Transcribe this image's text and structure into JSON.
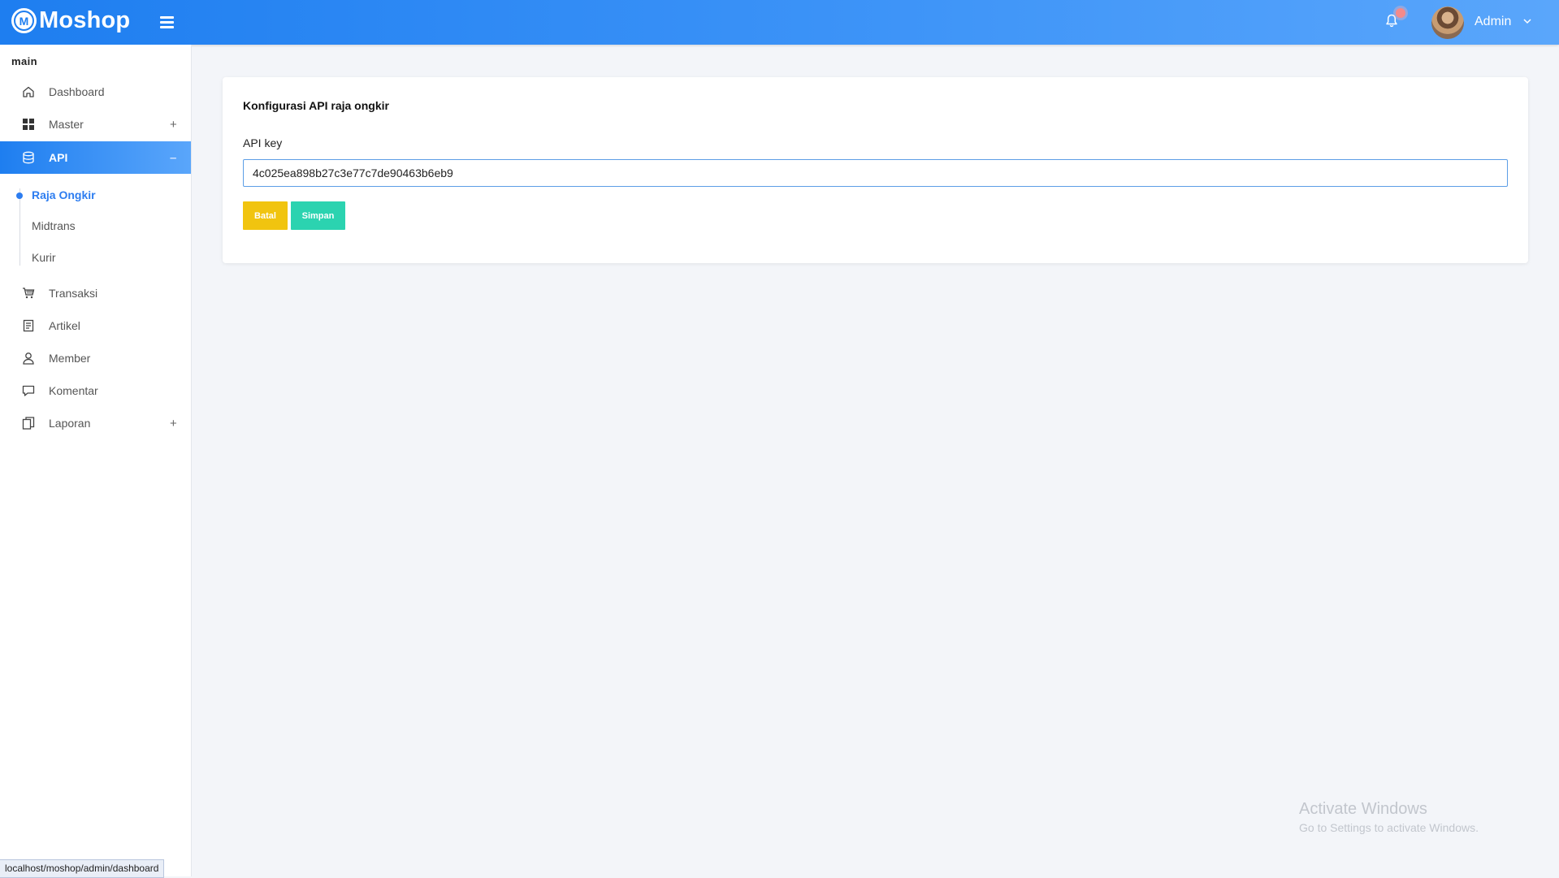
{
  "header": {
    "brand": "Moshop",
    "logo_letter": "M",
    "user_name": "Admin",
    "accent_color": "#1e7ef0"
  },
  "sidebar": {
    "section_title": "main",
    "items": [
      {
        "label": "Dashboard",
        "icon": "home-icon"
      },
      {
        "label": "Master",
        "icon": "grid-icon",
        "toggle": "+"
      },
      {
        "label": "API",
        "icon": "database-icon",
        "toggle": "–",
        "active": true
      },
      {
        "label": "Transaksi",
        "icon": "cart-icon"
      },
      {
        "label": "Artikel",
        "icon": "article-icon"
      },
      {
        "label": "Member",
        "icon": "user-icon"
      },
      {
        "label": "Komentar",
        "icon": "comment-icon"
      },
      {
        "label": "Laporan",
        "icon": "report-icon",
        "toggle": "+"
      }
    ],
    "api_submenu": [
      {
        "label": "Raja Ongkir",
        "active": true
      },
      {
        "label": "Midtrans"
      },
      {
        "label": "Kurir"
      }
    ]
  },
  "main": {
    "card_title": "Konfigurasi API raja ongkir",
    "api_key_label": "API key",
    "api_key_value": "4c025ea898b27c3e77c7de90463b6eb9",
    "cancel_label": "Batal",
    "save_label": "Simpan"
  },
  "status_bar": {
    "url": "localhost/moshop/admin/dashboard"
  },
  "watermark": {
    "title": "Activate Windows",
    "subtitle": "Go to Settings to activate Windows."
  }
}
